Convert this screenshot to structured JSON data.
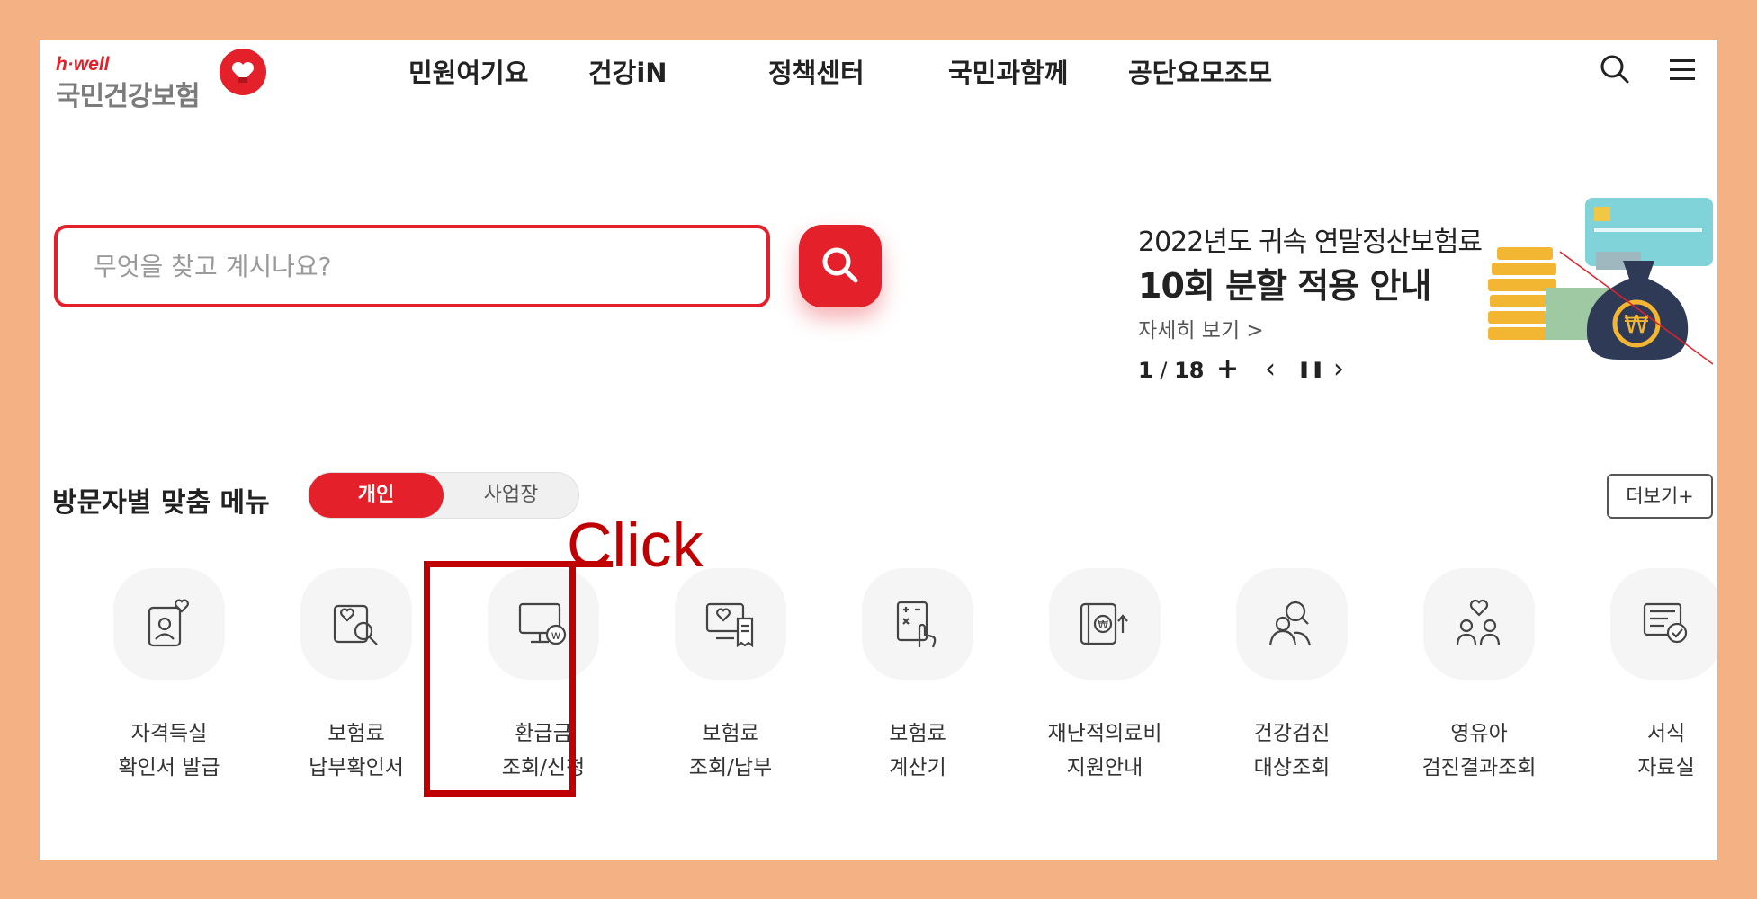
{
  "logo": {
    "brand_small": "h·well",
    "brand_name": "국민건강보험"
  },
  "nav": {
    "items": [
      {
        "label": "민원여기요"
      },
      {
        "label": "건강iN"
      },
      {
        "label": "정책센터"
      },
      {
        "label": "국민과함께"
      },
      {
        "label": "공단요모조모"
      }
    ],
    "search_icon": "search-icon",
    "menu_icon": "hamburger-menu-icon"
  },
  "search": {
    "placeholder": "무엇을 찾고 계시나요?",
    "value": "",
    "button_icon": "search-icon"
  },
  "banner": {
    "line1": "2022년도 귀속 연말정산보험료",
    "line2": "10회 분할 적용 안내",
    "more": "자세히 보기 >",
    "page_current": "1",
    "page_separator": "/",
    "page_total": "18",
    "controls": {
      "add": "+",
      "prev": "‹",
      "pause": "❚❚",
      "next": "›"
    }
  },
  "visitor_menu": {
    "title": "방문자별 맞춤 메뉴",
    "toggle": {
      "active": "개인",
      "inactive": "사업장"
    },
    "more_button": "더보기+",
    "items": [
      {
        "line1": "자격득실",
        "line2": "확인서 발급",
        "icon": "id-card-heart-icon"
      },
      {
        "line1": "보험료",
        "line2": "납부확인서",
        "icon": "document-search-icon"
      },
      {
        "line1": "환급금",
        "line2": "조회/신청",
        "icon": "monitor-won-icon"
      },
      {
        "line1": "보험료",
        "line2": "조회/납부",
        "icon": "monitor-receipt-icon"
      },
      {
        "line1": "보험료",
        "line2": "계산기",
        "icon": "calculator-hand-icon"
      },
      {
        "line1": "재난적의료비",
        "line2": "지원안내",
        "icon": "won-coin-arrow-icon"
      },
      {
        "line1": "건강검진",
        "line2": "대상조회",
        "icon": "people-search-icon"
      },
      {
        "line1": "영유아",
        "line2": "검진결과조회",
        "icon": "family-heart-icon"
      },
      {
        "line1": "서식",
        "line2": "자료실",
        "icon": "form-check-icon"
      }
    ]
  },
  "annotation": {
    "text": "Click",
    "color": "#c00000"
  },
  "colors": {
    "accent": "#e4202a",
    "frame": "#f4b183",
    "annotation": "#c00000"
  }
}
